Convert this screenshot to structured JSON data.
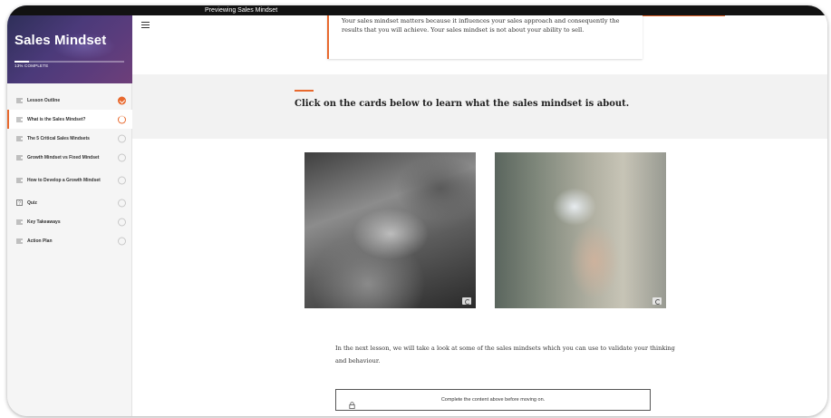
{
  "preview_bar": {
    "text": "Previewing Sales Mindset"
  },
  "sidebar": {
    "course_title": "Sales Mindset",
    "progress_percent": 13,
    "progress_text": "13% COMPLETE",
    "items": [
      {
        "label": "Lesson Outline",
        "icon": "lines-icon",
        "status": "complete"
      },
      {
        "label": "What is the Sales Mindset?",
        "icon": "lines-icon",
        "status": "in-progress",
        "active": true
      },
      {
        "label": "The 5 Critical Sales Mindsets",
        "icon": "lines-icon",
        "status": "not-started"
      },
      {
        "label": "Growth Mindset vs Fixed Mindset",
        "icon": "lines-icon",
        "status": "not-started"
      },
      {
        "label": "How to Develop a Growth Mindset",
        "icon": "lines-icon",
        "status": "not-started"
      },
      {
        "label": "Quiz",
        "icon": "quiz-icon",
        "status": "not-started"
      },
      {
        "label": "Key Takeaways",
        "icon": "lines-icon",
        "status": "not-started"
      },
      {
        "label": "Action Plan",
        "icon": "lines-icon",
        "status": "not-started"
      }
    ]
  },
  "main": {
    "intro_text": "Your sales mindset matters because it influences your sales approach and consequently the results that you will achieve. Your sales mindset is not about your ability to sell.",
    "cards_heading": "Click on the cards below to learn what the sales mindset is about.",
    "next_text": "In the next lesson, we will take a look at some of the sales mindsets which you can use to validate your thinking and behaviour.",
    "continue_label": "Complete the content above before moving on."
  },
  "colors": {
    "accent": "#e8692e",
    "sidebar_header": "#4b3a7a"
  }
}
